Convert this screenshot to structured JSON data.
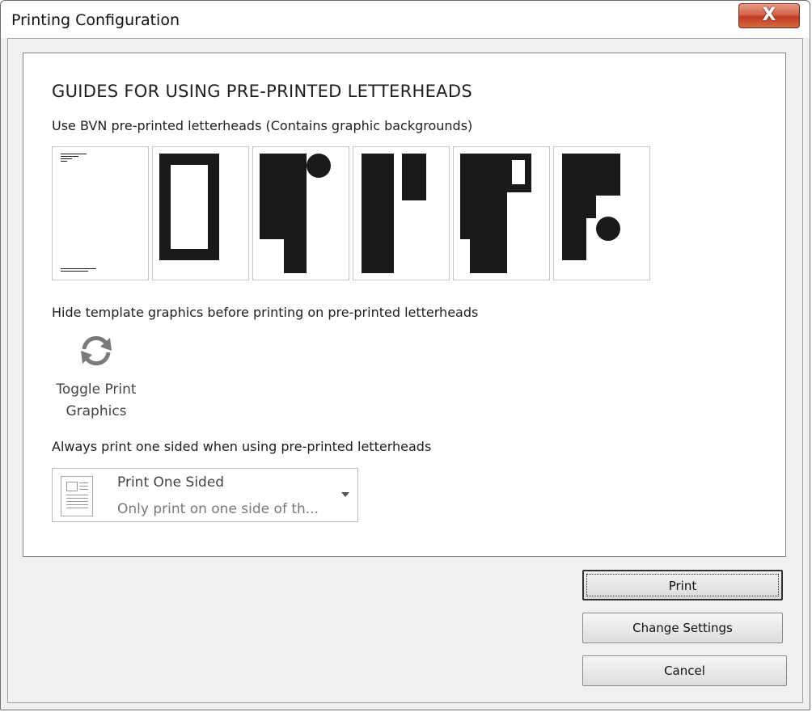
{
  "window": {
    "title": "Printing Configuration",
    "close_glyph": "X"
  },
  "panel": {
    "heading": "GUIDES FOR USING PRE-PRINTED LETTERHEADS",
    "letterheads_label": "Use BVN pre-printed letterheads (Contains graphic backgrounds)",
    "letterheads": [
      {
        "name": "letterhead-plain"
      },
      {
        "name": "letterhead-frame"
      },
      {
        "name": "letterhead-block-circle"
      },
      {
        "name": "letterhead-bars"
      },
      {
        "name": "letterhead-block-window"
      },
      {
        "name": "letterhead-block-dot"
      }
    ],
    "hide_label": "Hide template graphics before printing on pre-printed letterheads",
    "toggle": {
      "icon": "refresh-icon",
      "label_line1": "Toggle Print",
      "label_line2": "Graphics"
    },
    "one_sided_label": "Always print one sided when using pre-printed letterheads",
    "print_mode": {
      "icon": "document-icon",
      "title": "Print One Sided",
      "subtitle": "Only print on one side of th..."
    }
  },
  "buttons": {
    "print": "Print",
    "change_settings": "Change Settings",
    "cancel": "Cancel"
  },
  "colors": {
    "graphic": "#1a1a1a",
    "close_button": "#c23a1e",
    "dialog_background": "#f0f0f0"
  }
}
